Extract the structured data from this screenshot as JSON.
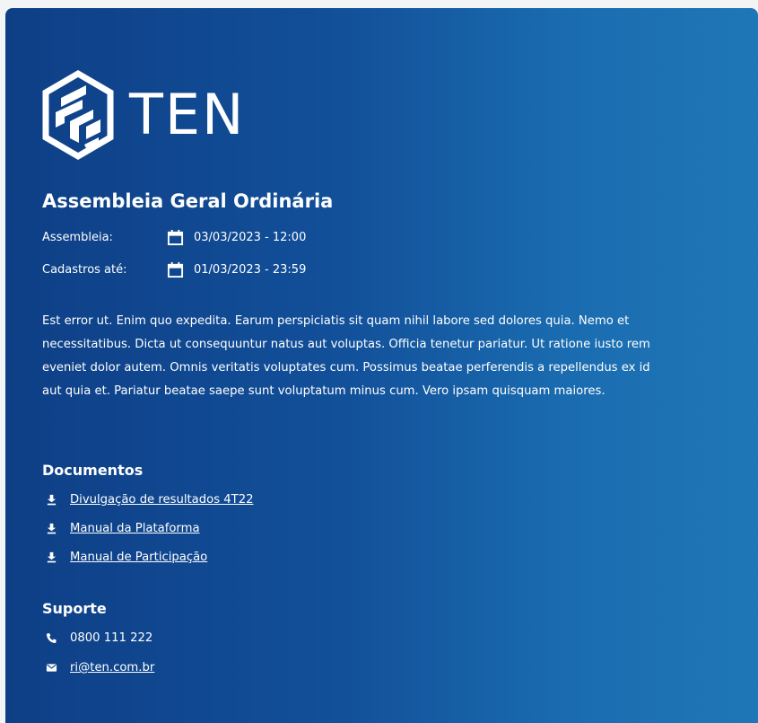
{
  "brand": {
    "name": "TEN"
  },
  "meeting": {
    "title": "Assembleia Geral Ordinária",
    "assembly_label": "Assembleia:",
    "assembly_date": "03/03/2023 - 12:00",
    "registration_label": "Cadastros até:",
    "registration_date": "01/03/2023 - 23:59",
    "description": "Est error ut. Enim quo expedita. Earum perspiciatis sit quam nihil labore sed dolores quia. Nemo et necessitatibus. Dicta ut consequuntur natus aut voluptas. Officia tenetur pariatur. Ut ratione iusto rem eveniet dolor autem. Omnis veritatis voluptates cum. Possimus beatae perferendis a repellendus ex id aut quia et. Pariatur beatae saepe sunt voluptatum minus cum. Vero ipsam quisquam maiores."
  },
  "documents": {
    "heading": "Documentos",
    "items": [
      {
        "label": "Divulgação de resultados 4T22",
        "icon": "download-icon"
      },
      {
        "label": "Manual da Plataforma",
        "icon": "download-icon"
      },
      {
        "label": "Manual de Participação",
        "icon": "download-icon"
      }
    ]
  },
  "support": {
    "heading": "Suporte",
    "phone": "0800 111 222",
    "email": "ri@ten.com.br",
    "phone_icon": "phone-icon",
    "email_icon": "mail-icon"
  },
  "colors": {
    "panel_gradient_start": "#0e3f86",
    "panel_gradient_end": "#1f77b7",
    "text": "#ffffff"
  }
}
